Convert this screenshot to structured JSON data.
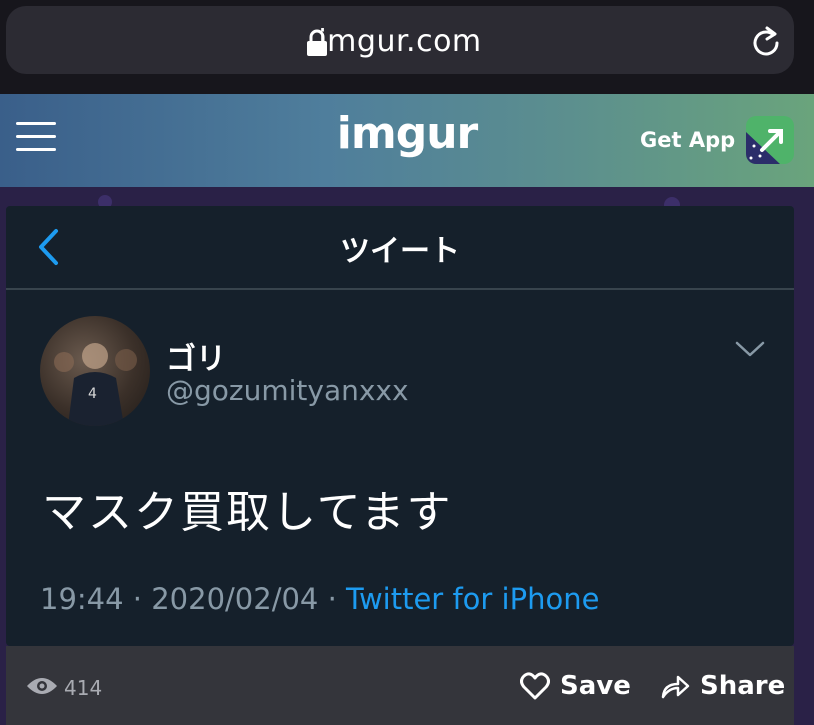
{
  "browser": {
    "url": "imgur.com",
    "icons": {
      "lock": "lock-icon",
      "reload": "reload-icon"
    }
  },
  "header": {
    "logo": "imgur",
    "get_app_label": "Get App",
    "colors": {
      "gradient_start": "#3a5f8a",
      "gradient_end": "#6aa47c",
      "app_icon": "#4fb36a"
    }
  },
  "tweet": {
    "nav_title": "ツイート",
    "display_name": "ゴリ",
    "handle": "@gozumityanxxx",
    "text": "マスク買取してます",
    "timestamp": "19:44 · 2020/02/04 · ",
    "source": "Twitter for iPhone",
    "colors": {
      "background": "#15202b",
      "secondary_text": "#8899a6",
      "link": "#1d9bf0"
    }
  },
  "post_actions": {
    "views": "414",
    "save_label": "Save",
    "share_label": "Share"
  }
}
